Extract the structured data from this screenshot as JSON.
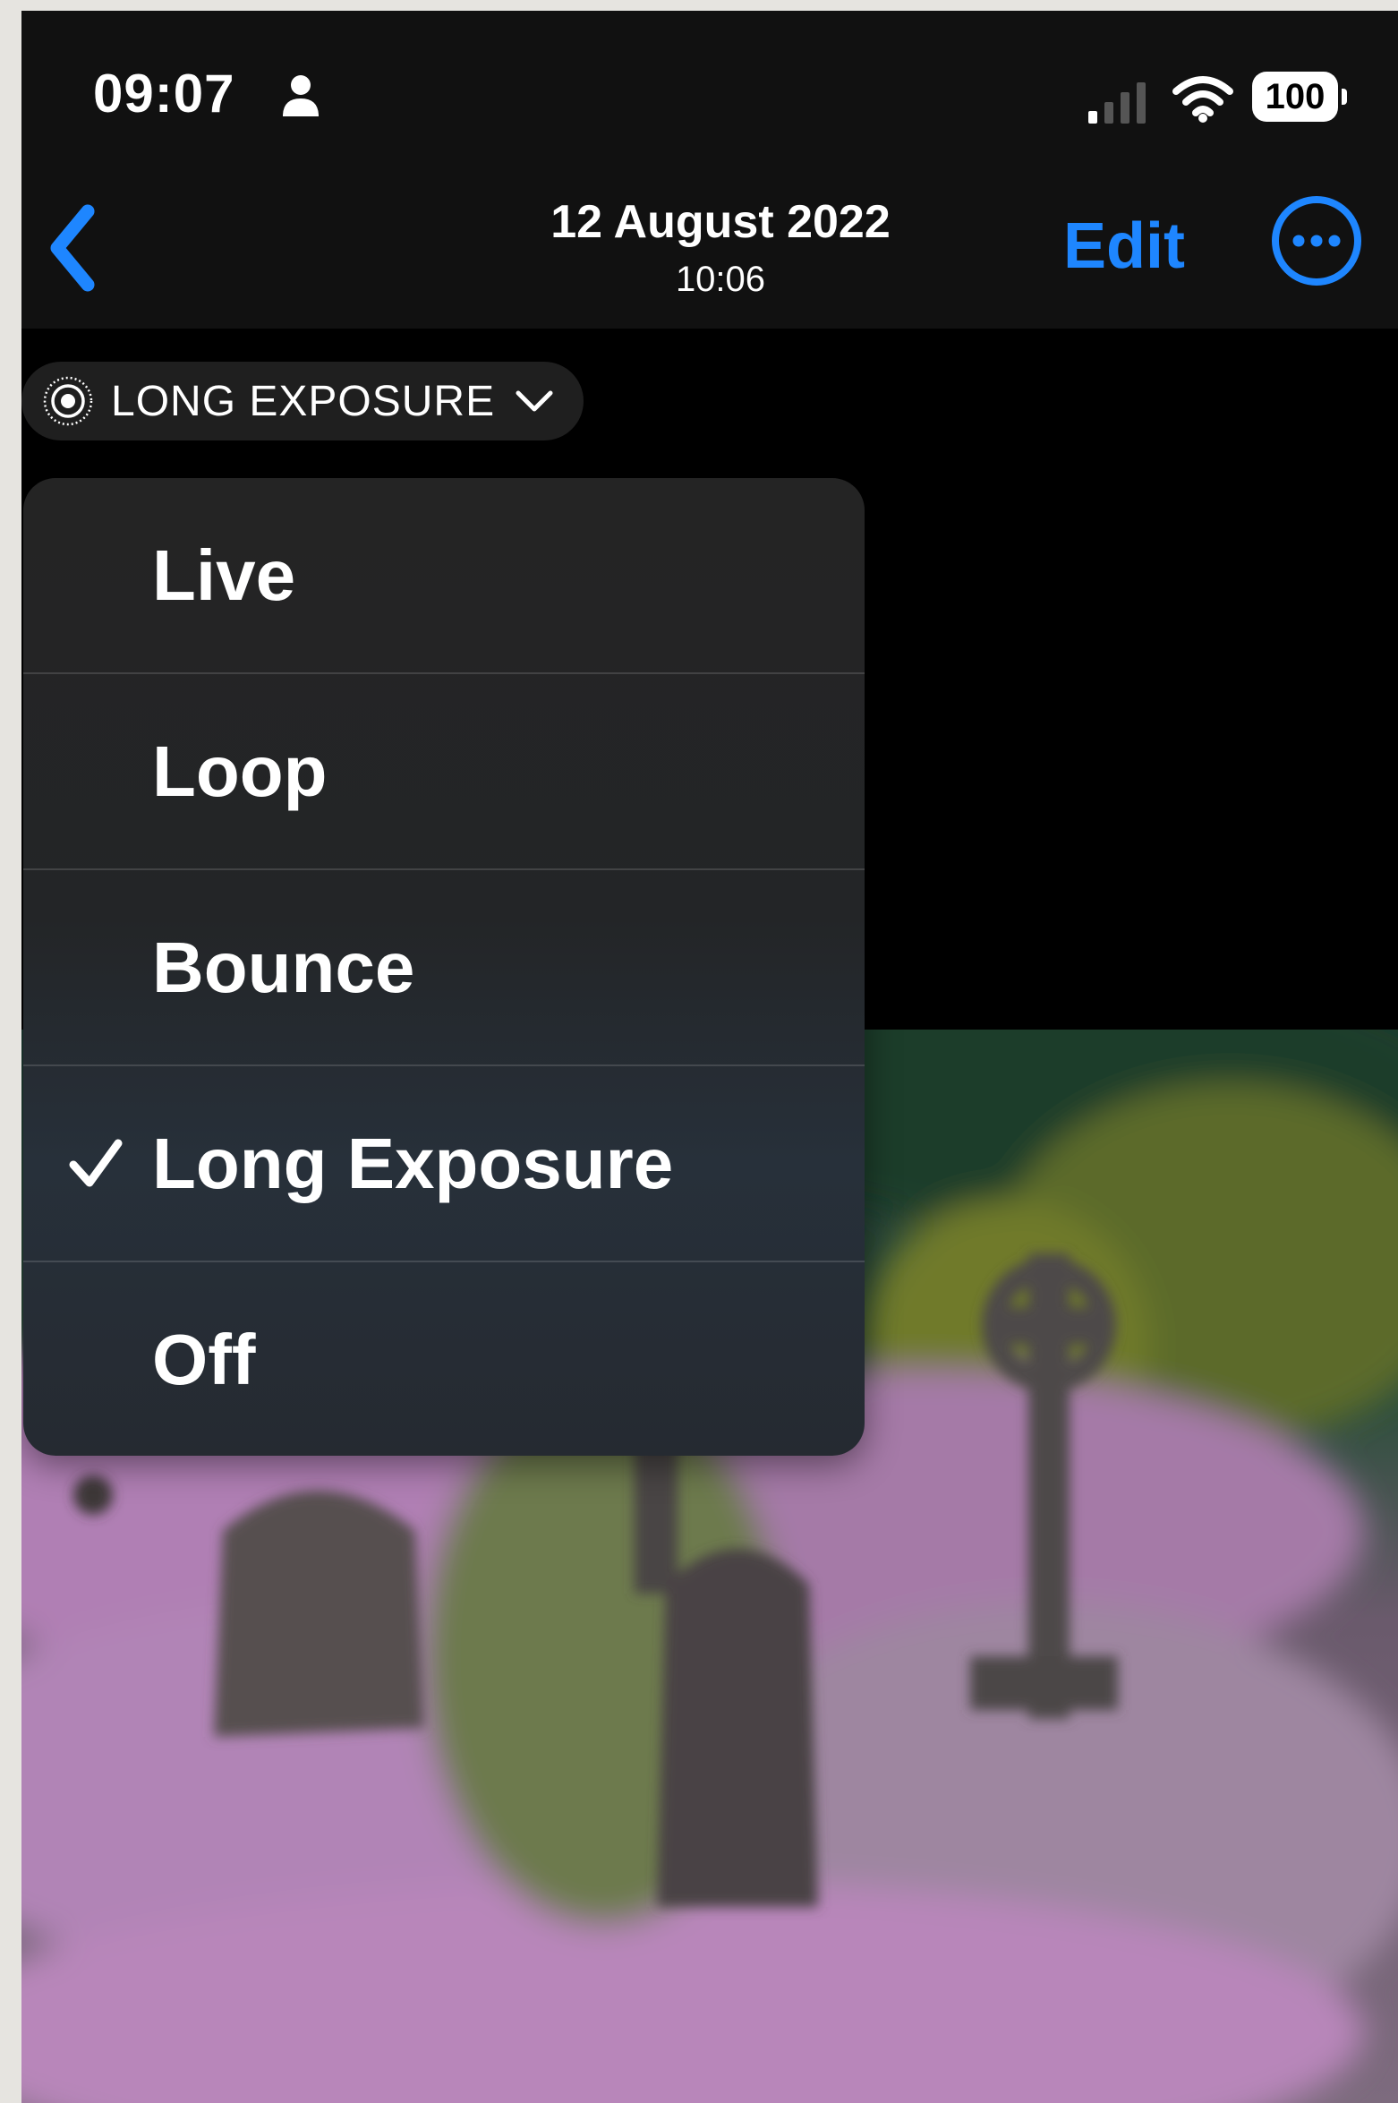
{
  "status_bar": {
    "time": "09:07",
    "battery": "100",
    "icons": [
      "person-icon",
      "cellular-signal-icon",
      "wifi-icon",
      "battery-icon"
    ]
  },
  "nav": {
    "date": "12 August 2022",
    "time": "10:06",
    "edit_label": "Edit",
    "back_icon": "chevron-left-icon",
    "more_icon": "ellipsis-circle-icon"
  },
  "mode_chip": {
    "label": "LONG EXPOSURE",
    "icon": "live-photo-icon",
    "chevron": "chevron-down-icon"
  },
  "menu": {
    "items": [
      {
        "label": "Live",
        "selected": false
      },
      {
        "label": "Loop",
        "selected": false
      },
      {
        "label": "Bounce",
        "selected": false
      },
      {
        "label": "Long Exposure",
        "selected": true
      },
      {
        "label": "Off",
        "selected": false
      }
    ]
  },
  "colors": {
    "accent": "#1e86ff",
    "background": "#000000",
    "menu_background": "#242424",
    "text": "#ffffff"
  }
}
